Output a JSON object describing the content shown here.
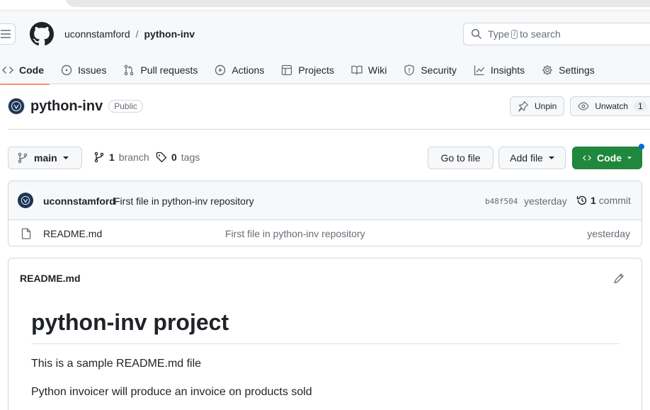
{
  "header": {
    "owner": "uconnstamford",
    "separator": "/",
    "repo": "python-inv",
    "search_prefix": "Type",
    "search_key": "/",
    "search_suffix": "to search"
  },
  "tabs": [
    {
      "label": "Code",
      "icon": "code-icon",
      "active": true
    },
    {
      "label": "Issues",
      "icon": "issue-opened-icon"
    },
    {
      "label": "Pull requests",
      "icon": "git-pull-request-icon"
    },
    {
      "label": "Actions",
      "icon": "play-icon"
    },
    {
      "label": "Projects",
      "icon": "table-icon"
    },
    {
      "label": "Wiki",
      "icon": "book-icon"
    },
    {
      "label": "Security",
      "icon": "shield-icon"
    },
    {
      "label": "Insights",
      "icon": "graph-icon"
    },
    {
      "label": "Settings",
      "icon": "gear-icon"
    }
  ],
  "repo": {
    "name": "python-inv",
    "visibility": "Public",
    "unpin_label": "Unpin",
    "unwatch_label": "Unwatch",
    "watch_count": "1"
  },
  "branch_bar": {
    "branch": "main",
    "branch_count": "1",
    "branch_label": "branch",
    "tag_count": "0",
    "tag_label": "tags",
    "go_to_file": "Go to file",
    "add_file": "Add file",
    "code": "Code"
  },
  "latest_commit": {
    "author": "uconnstamford",
    "message": "First file in python-inv repository",
    "sha": "b48f504",
    "time": "yesterday",
    "count": "1",
    "count_label": "commit"
  },
  "files": [
    {
      "name": "README.md",
      "commit_message": "First file in python-inv repository",
      "time": "yesterday"
    }
  ],
  "readme": {
    "filename": "README.md",
    "heading": "python-inv project",
    "paragraphs": [
      "This is a sample README.md file",
      "Python invoicer will produce an invoice on products sold"
    ]
  },
  "colors": {
    "accent_underline": "#fd8c73",
    "code_button": "#1f883d",
    "notification_dot": "#0969da"
  }
}
